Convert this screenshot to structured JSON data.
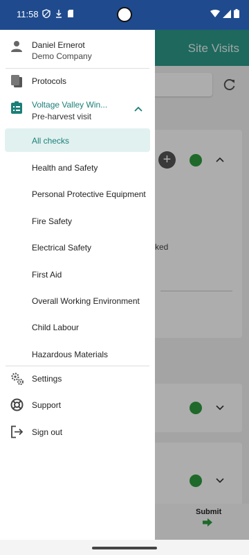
{
  "status_bar": {
    "time": "11:58"
  },
  "background": {
    "title": "Site Visits",
    "partial_text": "ked",
    "submit_label": "Submit"
  },
  "drawer": {
    "user": {
      "name": "Daniel Ernerot",
      "company": "Demo Company"
    },
    "protocols_label": "Protocols",
    "site": {
      "title": "Voltage Valley Win...",
      "subtitle": "Pre-harvest visit"
    },
    "check_items": [
      "All checks",
      "Health and Safety",
      "Personal Protective Equipment",
      "Fire Safety",
      "Electrical Safety",
      "First Aid",
      "Overall Working Environment",
      "Child Labour",
      "Hazardous Materials"
    ],
    "footer_items": [
      "Settings",
      "Support",
      "Sign out"
    ]
  },
  "colors": {
    "accent": "#1a7f78",
    "header_bg": "#2d9a8a",
    "status_bar": "#1f4b8e",
    "active_bg": "#e1f1f0",
    "check_green": "#2e9b3f"
  },
  "icons": [
    "person-icon",
    "clipboard-icon",
    "checklist-icon",
    "chevron-up-icon",
    "gear-icon",
    "support-icon",
    "sign-out-icon",
    "refresh-icon",
    "plus-icon",
    "check-icon",
    "chevron-down-icon",
    "arrow-right-icon"
  ]
}
